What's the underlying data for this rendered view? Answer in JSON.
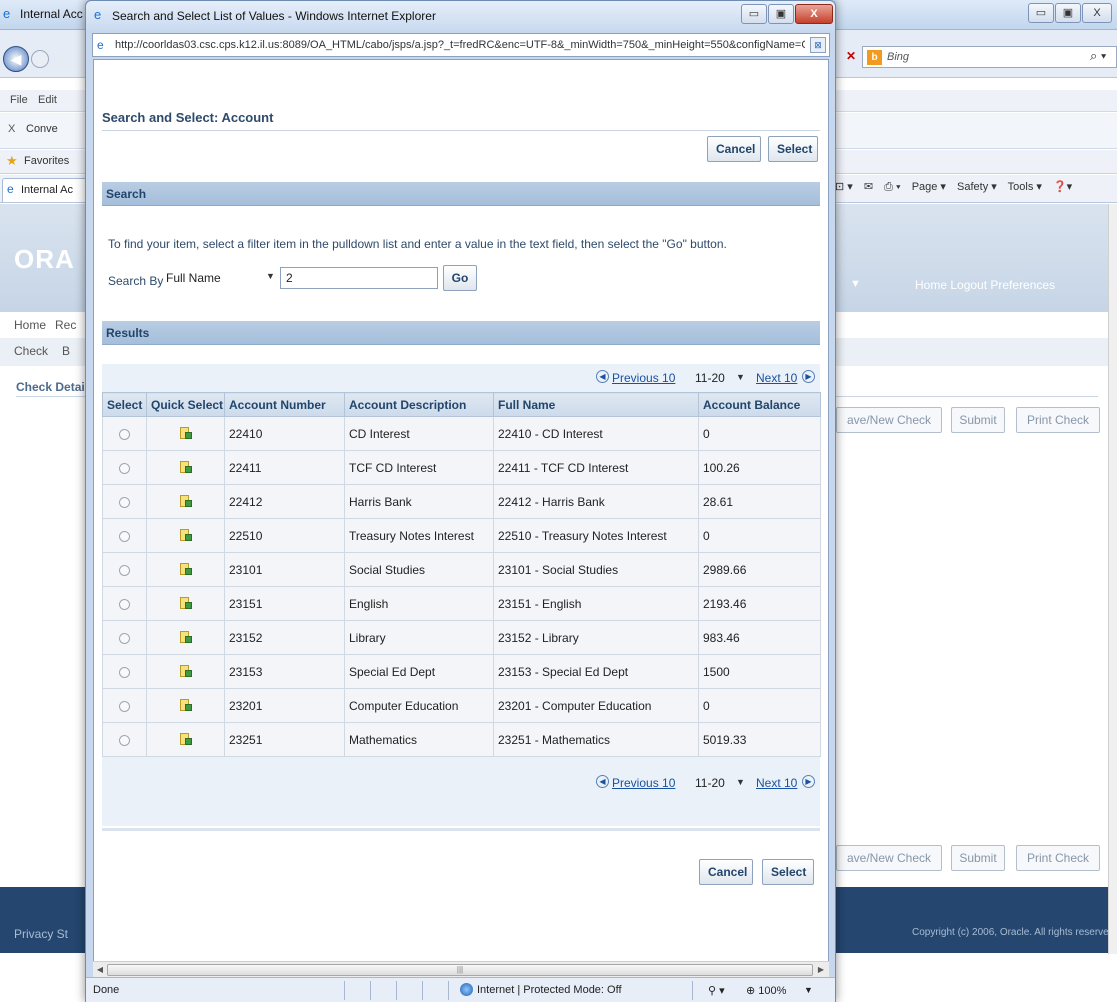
{
  "background": {
    "window_title": "Internal Acc",
    "tab_title": "Internal Ac",
    "menu": [
      "File",
      "Edit"
    ],
    "toolbar_item": "Conve",
    "favorites_label": "Favorites",
    "search_box_placeholder": "Bing",
    "command_bar": [
      "Page ▾",
      "Safety ▾",
      "Tools ▾"
    ],
    "oracle_logo": "ORA",
    "header_links": "Home  Logout  Preferences",
    "nav_tabs": [
      "Home",
      "Rec"
    ],
    "subnav": [
      "Check",
      "B"
    ],
    "section_title": "Check Detai",
    "buttons": [
      "ave/New Check",
      "Submit",
      "Print Check"
    ],
    "footer_left": "Privacy St",
    "footer_right": "Copyright (c) 2006, Oracle. All rights reserved."
  },
  "popup": {
    "title": "Search and Select List of Values - Windows Internet Explorer",
    "url": "http://coorldas03.csc.cps.k12.il.us:8089/OA_HTML/cabo/jsps/a.jsp?_t=fredRC&enc=UTF-8&_minWidth=750&_minHeight=550&configName=OACom",
    "window_buttons": {
      "minimize": "▭",
      "maximize": "▣",
      "close": "X"
    }
  },
  "lov": {
    "heading": "Search and Select: Account",
    "cancel_label": "Cancel",
    "select_label": "Select",
    "search_section": "Search",
    "instruction": "To find your item, select a filter item in the pulldown list and enter a value in the text field, then select the \"Go\" button.",
    "search_by_label": "Search By",
    "search_by_value": "Full Name",
    "search_value": "2",
    "go_label": "Go",
    "results_section": "Results",
    "pager": {
      "previous": "Previous 10",
      "range": "11-20",
      "next": "Next 10"
    },
    "columns": [
      "Select",
      "Quick Select",
      "Account Number",
      "Account Description",
      "Full Name",
      "Account Balance"
    ],
    "rows": [
      {
        "number": "22410",
        "description": "CD Interest",
        "full_name": "22410 - CD Interest",
        "balance": "0"
      },
      {
        "number": "22411",
        "description": "TCF CD Interest",
        "full_name": "22411 - TCF CD Interest",
        "balance": "100.26"
      },
      {
        "number": "22412",
        "description": "Harris Bank",
        "full_name": "22412 - Harris Bank",
        "balance": "28.61"
      },
      {
        "number": "22510",
        "description": "Treasury Notes Interest",
        "full_name": "22510 - Treasury Notes Interest",
        "balance": "0"
      },
      {
        "number": "23101",
        "description": "Social Studies",
        "full_name": "23101 - Social Studies",
        "balance": "2989.66"
      },
      {
        "number": "23151",
        "description": "English",
        "full_name": "23151 - English",
        "balance": "2193.46"
      },
      {
        "number": "23152",
        "description": "Library",
        "full_name": "23152 - Library",
        "balance": "983.46"
      },
      {
        "number": "23153",
        "description": "Special Ed Dept",
        "full_name": "23153 - Special Ed Dept",
        "balance": "1500"
      },
      {
        "number": "23201",
        "description": "Computer Education",
        "full_name": "23201 - Computer Education",
        "balance": "0"
      },
      {
        "number": "23251",
        "description": "Mathematics",
        "full_name": "23251 - Mathematics",
        "balance": "5019.33"
      }
    ]
  },
  "statusbar": {
    "status": "Done",
    "zone": "Internet | Protected Mode: Off",
    "zoom": "100%"
  }
}
